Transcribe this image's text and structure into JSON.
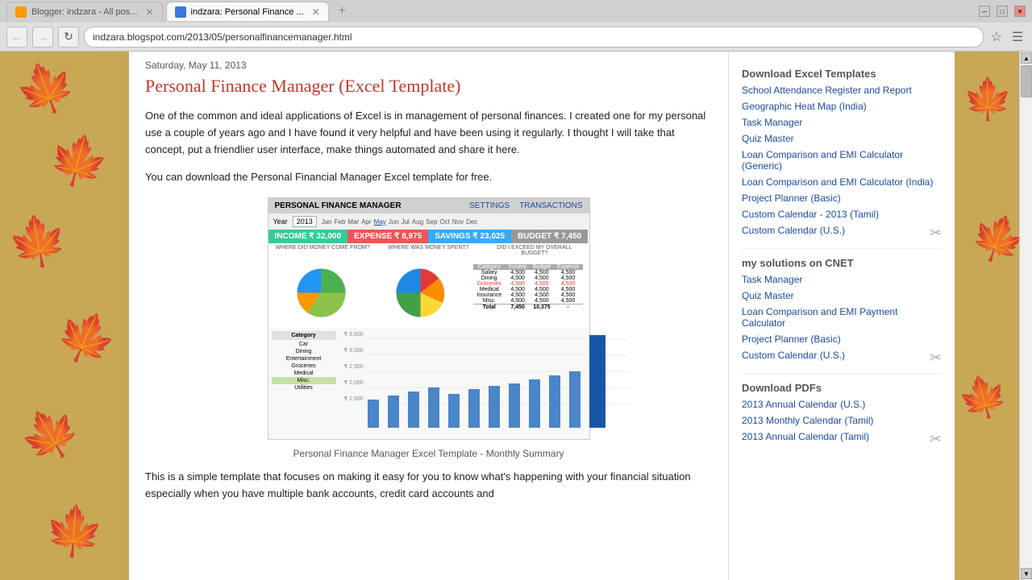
{
  "browser": {
    "tabs": [
      {
        "id": "tab1",
        "label": "Blogger: indzara - All pos...",
        "favicon": "blogger",
        "active": false
      },
      {
        "id": "tab2",
        "label": "indzara: Personal Finance ...",
        "favicon": "indzara",
        "active": true
      }
    ],
    "address": "indzara.blogspot.com/2013/05/personalfinancemanager.html",
    "new_tab_label": "+"
  },
  "post": {
    "date": "Saturday, May 11, 2013",
    "title": "Personal Finance Manager (Excel Template)",
    "body1": "One of the common and ideal applications of Excel is in management of personal finances. I created one for my personal use a couple of years ago and I have found it very helpful and have been using it regularly. I thought I will take that concept, put a friendlier user interface, make things automated and share it here.",
    "body2": "You can download the Personal Financial Manager Excel template for free.",
    "image_caption": "Personal Finance Manager Excel Template - Monthly Summary",
    "body3": "This is a simple template that focuses on making it easy for you to know what's happening with your financial situation especially when you have multiple bank accounts, credit card accounts and"
  },
  "dashboard": {
    "title": "PERSONAL FINANCE MANAGER",
    "link1": "SETTINGS",
    "link2": "TRANSACTIONS",
    "year_label": "Year",
    "year_value": "2013",
    "months": [
      "Jan",
      "Feb",
      "Mar",
      "Apr",
      "May",
      "Jun",
      "Jul",
      "Aug",
      "Sep",
      "Oct",
      "Nov",
      "Dec"
    ],
    "active_month": "May",
    "income_label": "INCOME",
    "income_value": "₹ 32,000",
    "expense_label": "EXPENSE",
    "expense_value": "₹ 8,975",
    "savings_label": "SAVINGS",
    "savings_value": "₹ 23,025",
    "budget_label": "BUDGET",
    "budget_value": "₹ 7,450",
    "section1": "WHERE DID MONEY COME FROM?",
    "section2": "WHERE WAS MONEY SPENT?",
    "section3": "DID I EXCEED MY OVERALL BUDGET?"
  },
  "sidebar": {
    "download_title": "Download Excel Templates",
    "links": [
      "School Attendance Register and Report",
      "Geographic Heat Map (India)",
      "Task Manager",
      "Quiz Master",
      "Loan Comparison and EMI Calculator (Generic)",
      "Loan Comparison and EMI Calculator (India)",
      "Project Planner (Basic)",
      "Custom Calendar - 2013 (Tamil)",
      "Custom Calendar (U.S.)"
    ],
    "cnet_title": "my solutions on CNET",
    "cnet_links": [
      "Task Manager",
      "Quiz Master",
      "Loan Comparison and EMI Payment Calculator",
      "Project Planner (Basic)",
      "Custom Calendar (U.S.)"
    ],
    "pdf_title": "Download PDFs",
    "pdf_links": [
      "2013 Annual Calendar (U.S.)",
      "2013 Monthly Calendar (Tamil)",
      "2013 Annual Calendar (Tamil)"
    ]
  }
}
